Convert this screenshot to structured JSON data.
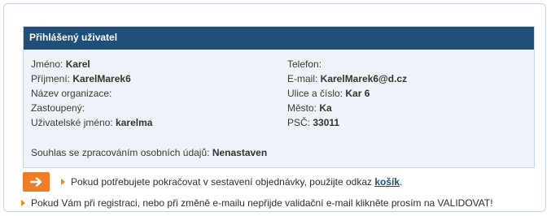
{
  "panel": {
    "title": "Přihlášený uživatel",
    "left_fields": [
      {
        "label": "Jméno: ",
        "value": "Karel"
      },
      {
        "label": "Příjmení: ",
        "value": "KarelMarek6"
      },
      {
        "label": "Název organizace:",
        "value": ""
      },
      {
        "label": "Zastoupený:",
        "value": ""
      },
      {
        "label": "Uživatelské jméno: ",
        "value": "karelma"
      }
    ],
    "right_fields": [
      {
        "label": "Telefon:",
        "value": ""
      },
      {
        "label": "E-mail: ",
        "value": "KarelMarek6@d.cz"
      },
      {
        "label": "Ulice a číslo: ",
        "value": "Kar 6"
      },
      {
        "label": "Město: ",
        "value": "Ka"
      },
      {
        "label": "PSČ: ",
        "value": "33011"
      }
    ],
    "consent_label": "Souhlas se zpracováním osobních údajů: ",
    "consent_value": "Nenastaven"
  },
  "notes": {
    "continue_prefix": "Pokud potřebujete pokračovat v sestavení objednávky, použijte odkaz ",
    "continue_link": "košík",
    "continue_suffix": ".",
    "validate_text": "Pokud Vám při registraci, nebo při změně e-mailu nepřijde validační e-mail klikněte prosím na VALIDOVAT!"
  },
  "colors": {
    "header_bg": "#1f4e79",
    "accent_orange": "#ef7d27"
  },
  "icons": {
    "continue": "arrow-right-icon",
    "bullet": "triangle-bullet-icon"
  }
}
